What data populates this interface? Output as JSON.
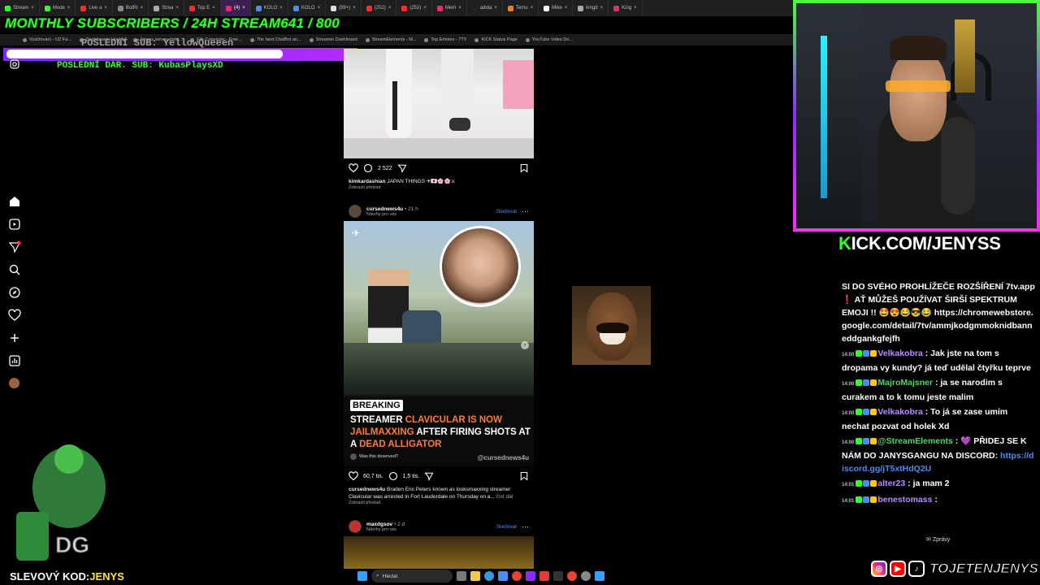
{
  "overlay": {
    "subs_goal": "MONTHLY SUBSCRIBERS / 24H STREAM641 / 800",
    "last_sub": "POSLEDNÍ SUB: YellowQueeen",
    "last_donation": "POSLEDNÍ DAR. SUB: KubasPlaysXD",
    "kick_url_prefix": "K",
    "kick_url_rest": "ICK.COM/JENYSS",
    "promo_label": "SLEVOVÝ KOD:",
    "promo_code": "JENYS",
    "social_handle": "TOJETENJENYS",
    "accent": "#35ff2a"
  },
  "browser": {
    "tabs": [
      {
        "label": "Stream",
        "color": "#35ff2a",
        "active": false
      },
      {
        "label": "Mode",
        "color": "#35ff2a",
        "active": false
      },
      {
        "label": "Live a",
        "color": "#ff2b2b",
        "active": false
      },
      {
        "label": "BotRi",
        "color": "#888",
        "active": false
      },
      {
        "label": "Strea",
        "color": "#aaa",
        "active": false
      },
      {
        "label": "Top E",
        "color": "#ff2b2b",
        "active": false
      },
      {
        "label": "(4)",
        "color": "#e1306c",
        "active": true
      },
      {
        "label": "KOLO",
        "color": "#4c8cf5",
        "active": false
      },
      {
        "label": "KOLO",
        "color": "#4c8cf5",
        "active": false
      },
      {
        "label": "(99+)",
        "color": "#ddd",
        "active": false
      },
      {
        "label": "(252)",
        "color": "#ff2b2b",
        "active": false
      },
      {
        "label": "(252)",
        "color": "#ff2b2b",
        "active": false
      },
      {
        "label": "Mem",
        "color": "#e1306c",
        "active": false
      },
      {
        "label": "adida",
        "color": "#222",
        "active": false
      },
      {
        "label": "Temu",
        "color": "#ff7a1a",
        "active": false
      },
      {
        "label": "Mike",
        "color": "#fff",
        "active": false
      },
      {
        "label": "kingd",
        "color": "#aaa",
        "active": false
      },
      {
        "label": "King",
        "color": "#e1306c",
        "active": false
      }
    ],
    "bookmarks": [
      "Vyúčtování - O2 Fa...",
      "Dashboard | Hostify",
      "Jenyss server strea...",
      "File Converter - Free...",
      "The best ChatBot an...",
      "Streamer Dashboard",
      "StreamElements - M...",
      "Top Emotes - 7TV",
      "KICK Status Page",
      "YouTube Video Do..."
    ]
  },
  "feed": {
    "post1": {
      "likes_icon": "heart-icon",
      "comments": "2 522",
      "username": "kimkardashian",
      "caption": "JAPAN THINGS ✈🇯🇵🌸🌸⚔",
      "translate": "Zobrazit překlad"
    },
    "post2": {
      "username": "cursednews4u",
      "time": "• 21 h",
      "subtitle": "Návrhy pro vás",
      "follow": "Sledovat",
      "breaking": "BREAKING",
      "headline_parts": [
        "STREAMER ",
        "CLAVICULAR IS NOW ",
        "JAILMAXXING",
        " AFTER FIRING SHOTS AT A ",
        "DEAD ALLIGATOR"
      ],
      "question": "Was this deserved?",
      "watermark": "@cursednews4u",
      "likes": "60,7 tis.",
      "comments": "1,5 tis.",
      "caption_user": "cursednews4u",
      "caption": "Braden Eric Peters known as looksmaxxing streamer Clavicular was arrested in Fort Lauderdale on Thursday on a...",
      "more": "číst dál",
      "translate": "Zobrazit překlad"
    },
    "post3": {
      "username": "maxdgsov",
      "time": "• 2 d",
      "subtitle": "Návrhy pro vás",
      "follow": "Sledovat"
    }
  },
  "chat": {
    "messages": [
      {
        "time": "",
        "user": "",
        "user_color": "#fff",
        "text": "SI DO SVÉHO PROHLÍŽEČE ROZŠÍŘENÍ 7tv.app ❗ AŤ MŮŽEŠ POUŽÍVAT ŠIRŠÍ SPEKTRUM EMOJI !! 🤩😍😂😎😂",
        "link": "https://chromewebstore.google.com/detail/7tv/ammjkodgmmoknidbanneddgankgfejfh"
      },
      {
        "time": "14:00",
        "user": "Velkakobra",
        "user_color": "#b88cff",
        "text": "Jak jste na tom s dropama vy kundy? já teď udělal čtyřku teprve",
        "link": ""
      },
      {
        "time": "14:00",
        "user": "MajroMajsner",
        "user_color": "#4cd964",
        "text": "ja se narodim s curakem a to k tomu jeste malim",
        "link": ""
      },
      {
        "time": "14:00",
        "user": "Velkakobra",
        "user_color": "#b88cff",
        "text": "To já se zase umím nechat pozvat od holek Xd",
        "link": ""
      },
      {
        "time": "14:00",
        "user": "@StreamElements",
        "user_color": "#4cd964",
        "text": "💜 PŘIDEJ SE K NÁM DO JANYSGANGU NA DISCORD:",
        "link": "https://discord.gg/jT5xtHdQ2U"
      },
      {
        "time": "14:01",
        "user": "alter23",
        "user_color": "#b88cff",
        "text": "ja mam 2",
        "link": ""
      },
      {
        "time": "14:01",
        "user": "benestomass",
        "user_color": "#b88cff",
        "text": "",
        "link": ""
      }
    ],
    "footer": "Zprávy"
  },
  "taskbar": {
    "search_placeholder": "Hledat"
  }
}
